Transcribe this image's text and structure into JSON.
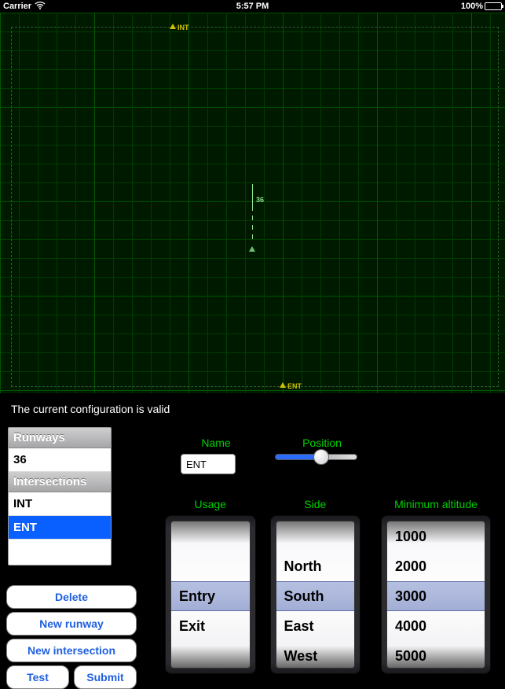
{
  "status_bar": {
    "carrier": "Carrier",
    "time": "5:57 PM",
    "battery_pct": "100%"
  },
  "radar": {
    "runway_label": "36",
    "marker_top": "INT",
    "marker_bottom": "ENT"
  },
  "status_text": "The current configuration is valid",
  "sidebar": {
    "headers": {
      "runways": "Runways",
      "intersections": "Intersections"
    },
    "runways": [
      "36"
    ],
    "intersections": [
      "INT",
      "ENT"
    ],
    "selected": "ENT"
  },
  "buttons": {
    "delete": "Delete",
    "new_runway": "New runway",
    "new_intersection": "New intersection",
    "test": "Test",
    "submit": "Submit"
  },
  "editor": {
    "name_label": "Name",
    "name_value": "ENT",
    "position_label": "Position",
    "position_value": 0.52,
    "usage_label": "Usage",
    "usage_options": [
      "Entry",
      "Exit"
    ],
    "usage_selected": "Entry",
    "side_label": "Side",
    "side_options": [
      "North",
      "South",
      "East",
      "West"
    ],
    "side_selected": "South",
    "minalt_label": "Minimum altitude",
    "minalt_options": [
      "1000",
      "2000",
      "3000",
      "4000",
      "5000"
    ],
    "minalt_selected": "3000"
  }
}
